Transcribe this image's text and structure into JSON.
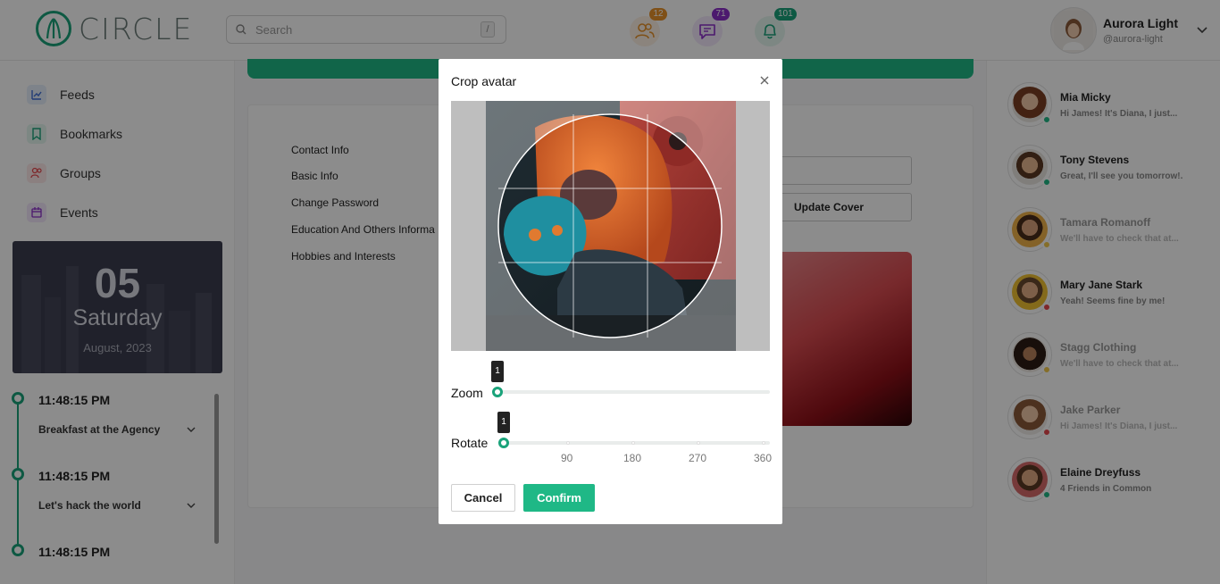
{
  "app": {
    "logo_text": "CIRCLE"
  },
  "search": {
    "placeholder": "Search",
    "shortcut": "/"
  },
  "notifications": [
    {
      "icon": "users-icon",
      "count": "12",
      "color": "#e7922b"
    },
    {
      "icon": "message-icon",
      "count": "71",
      "color": "#8b2fc9"
    },
    {
      "icon": "bell-icon",
      "count": "101",
      "color": "#1aa37a"
    }
  ],
  "user": {
    "name": "Aurora Light",
    "handle": "@aurora-light"
  },
  "sidebar": {
    "items": [
      {
        "label": "Feeds",
        "icon": "feeds-icon"
      },
      {
        "label": "Bookmarks",
        "icon": "bookmark-icon"
      },
      {
        "label": "Groups",
        "icon": "groups-icon"
      },
      {
        "label": "Events",
        "icon": "calendar-icon"
      }
    ]
  },
  "date_card": {
    "day": "05",
    "weekday": "Saturday",
    "month_year": "August, 2023"
  },
  "timeline": [
    {
      "time": "11:48:15 PM",
      "title": "Breakfast at the Agency"
    },
    {
      "time": "11:48:15 PM",
      "title": "Let's hack the world"
    },
    {
      "time": "11:48:15 PM",
      "title": ""
    }
  ],
  "settings_menu": [
    "Contact Info",
    "Basic Info",
    "Change Password",
    "Education And Others Informa",
    "Hobbies and Interests"
  ],
  "cover": {
    "button_label": "Update Cover"
  },
  "friends": [
    {
      "name": "Mia Micky",
      "message": "Hi James! It's Diana, I just...",
      "status_color": "#1fb886",
      "faded": false
    },
    {
      "name": "Tony Stevens",
      "message": "Great, I'll see you tomorrow!.",
      "status_color": "#1fb886",
      "faded": false
    },
    {
      "name": "Tamara Romanoff",
      "message": "We'll have to check that at...",
      "status_color": "#f2c94c",
      "faded": true
    },
    {
      "name": "Mary Jane Stark",
      "message": "Yeah! Seems fine by me!",
      "status_color": "#e5484d",
      "faded": false
    },
    {
      "name": "Stagg Clothing",
      "message": "We'll have to check that at...",
      "status_color": "#f2c94c",
      "faded": true
    },
    {
      "name": "Jake Parker",
      "message": "Hi James! It's Diana, I just...",
      "status_color": "#e5484d",
      "faded": true
    },
    {
      "name": "Elaine Dreyfuss",
      "message": "4 Friends in Common",
      "status_color": "#1fb886",
      "faded": false
    }
  ],
  "modal": {
    "title": "Crop avatar",
    "zoom": {
      "label": "Zoom",
      "value": "1"
    },
    "rotate": {
      "label": "Rotate",
      "value": "1",
      "ticks": [
        "90",
        "180",
        "270",
        "360"
      ]
    },
    "cancel_label": "Cancel",
    "confirm_label": "Confirm"
  },
  "colors": {
    "accent": "#1fb886",
    "overlay": "rgba(0,0,0,0.45)"
  }
}
